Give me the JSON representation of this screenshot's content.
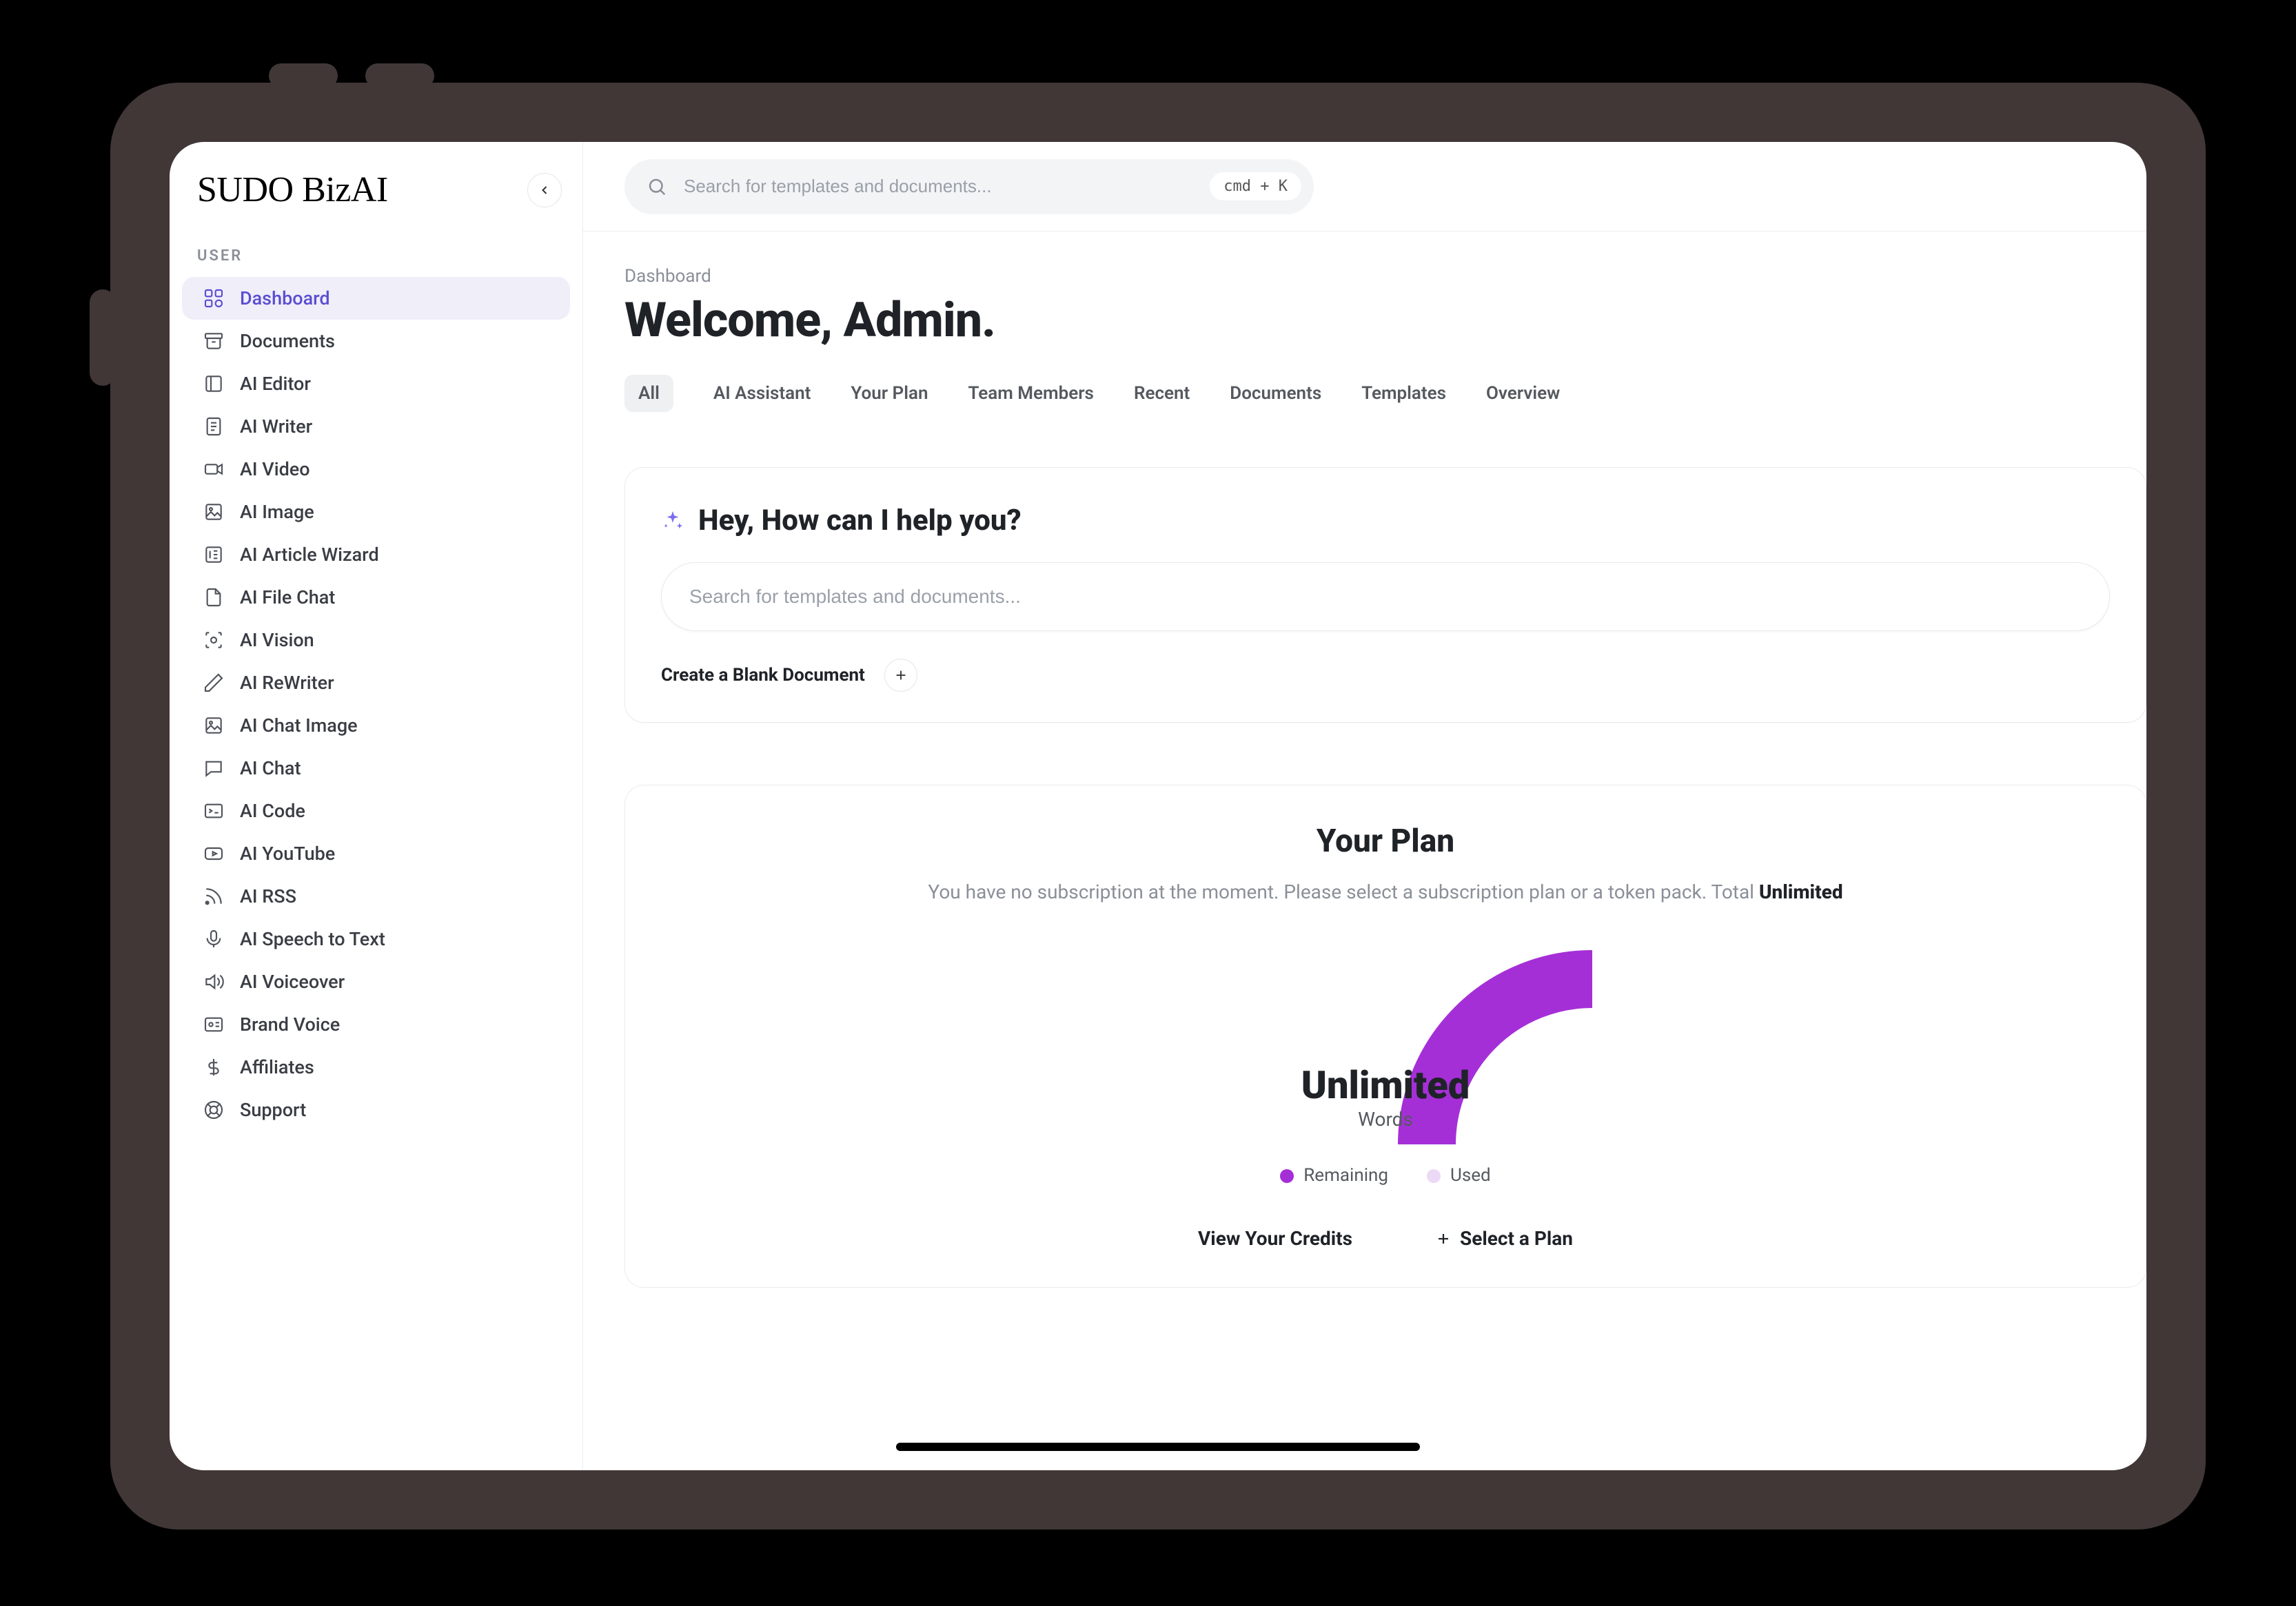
{
  "brand": "SUDO BizAI",
  "search": {
    "placeholder": "Search for templates and documents...",
    "kbd": "cmd + K"
  },
  "sidebar": {
    "section_label": "USER",
    "items": [
      {
        "label": "Dashboard"
      },
      {
        "label": "Documents"
      },
      {
        "label": "AI Editor"
      },
      {
        "label": "AI Writer"
      },
      {
        "label": "AI Video"
      },
      {
        "label": "AI Image"
      },
      {
        "label": "AI Article Wizard"
      },
      {
        "label": "AI File Chat"
      },
      {
        "label": "AI Vision"
      },
      {
        "label": "AI ReWriter"
      },
      {
        "label": "AI Chat Image"
      },
      {
        "label": "AI Chat"
      },
      {
        "label": "AI Code"
      },
      {
        "label": "AI YouTube"
      },
      {
        "label": "AI RSS"
      },
      {
        "label": "AI Speech to Text"
      },
      {
        "label": "AI Voiceover"
      },
      {
        "label": "Brand Voice"
      },
      {
        "label": "Affiliates"
      },
      {
        "label": "Support"
      }
    ]
  },
  "header": {
    "breadcrumb": "Dashboard",
    "welcome": "Welcome, Admin."
  },
  "tabs": [
    {
      "label": "All",
      "active": true
    },
    {
      "label": "AI Assistant"
    },
    {
      "label": "Your Plan"
    },
    {
      "label": "Team Members"
    },
    {
      "label": "Recent"
    },
    {
      "label": "Documents"
    },
    {
      "label": "Templates"
    },
    {
      "label": "Overview"
    }
  ],
  "help": {
    "heading": "Hey, How can I help you?",
    "search_placeholder": "Search for templates and documents...",
    "create_label": "Create a Blank Document"
  },
  "plan": {
    "title": "Your Plan",
    "subtext_prefix": "You have no subscription at the moment. Please select a subscription plan or a token pack. Total ",
    "subtext_bold": "Unlimited",
    "gauge_value": "Unlimited",
    "gauge_sub": "Words",
    "legend_remaining": "Remaining",
    "legend_used": "Used",
    "action_view": "View Your Credits",
    "action_select": "Select a Plan",
    "colors": {
      "remaining": "#a52fd7",
      "used": "#ecd9f5"
    }
  },
  "chart_data": {
    "type": "pie",
    "title": "Your Plan",
    "categories": [
      "Remaining",
      "Used"
    ],
    "values": [
      100,
      0
    ],
    "series": [
      {
        "name": "Words",
        "values": [
          100,
          0
        ]
      }
    ],
    "unit": "Words",
    "display_value": "Unlimited",
    "colors": [
      "#a52fd7",
      "#ecd9f5"
    ],
    "style": "semi-donut"
  }
}
